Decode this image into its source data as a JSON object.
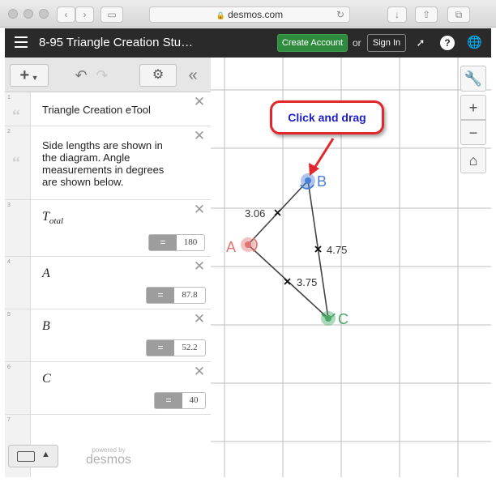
{
  "browser": {
    "url": "desmos.com",
    "back_icon": "chevron-left-icon",
    "forward_icon": "chevron-right-icon"
  },
  "header": {
    "title": "8-95 Triangle Creation Stu…",
    "create_account": "Create Account",
    "or": "or",
    "sign_in": "Sign In",
    "help": "?"
  },
  "toolbar": {
    "add": "+",
    "collapse": "«"
  },
  "expressions": [
    {
      "num": "1",
      "type": "note",
      "text": "Triangle Creation eTool"
    },
    {
      "num": "2",
      "type": "note",
      "text": "Side lengths are shown in the diagram. Angle measurements in degrees are shown below."
    },
    {
      "num": "3",
      "type": "math",
      "symbol": "T",
      "subscript": "otal",
      "eq": "=",
      "value": "180"
    },
    {
      "num": "4",
      "type": "math",
      "symbol": "A",
      "eq": "=",
      "value": "87.8"
    },
    {
      "num": "5",
      "type": "math",
      "symbol": "B",
      "eq": "=",
      "value": "52.2"
    },
    {
      "num": "6",
      "type": "math",
      "symbol": "C",
      "eq": "=",
      "value": "40"
    },
    {
      "num": "7",
      "type": "empty"
    }
  ],
  "footer": {
    "powered_by": "powered by",
    "logo": "desmos"
  },
  "graph": {
    "points": [
      {
        "label": "A",
        "color": "#e07373"
      },
      {
        "label": "B",
        "color": "#4a7fd6"
      },
      {
        "label": "C",
        "color": "#4aa869"
      }
    ],
    "side_labels": [
      "3.06",
      "4.75",
      "3.75"
    ],
    "callout": "Click and drag",
    "callout_border": "#e2262b",
    "callout_text_color": "#1d1dc8"
  },
  "right_tools": {
    "settings_icon": "wrench-icon",
    "zoom_in": "+",
    "zoom_out": "−",
    "home_icon": "home-icon"
  }
}
